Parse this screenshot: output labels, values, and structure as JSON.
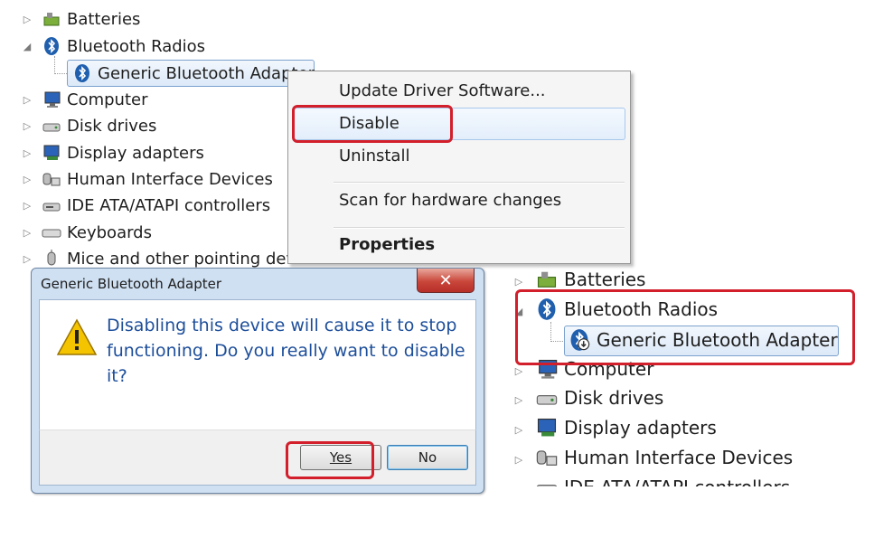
{
  "tree_top": {
    "items": [
      {
        "label": "Batteries",
        "icon": "battery-icon",
        "expanded": false
      },
      {
        "label": "Bluetooth Radios",
        "icon": "bluetooth-icon",
        "expanded": true
      },
      {
        "label": "Generic Bluetooth Adapter",
        "icon": "bluetooth-icon",
        "child": true,
        "selected": true
      },
      {
        "label": "Computer",
        "icon": "computer-icon",
        "expanded": false
      },
      {
        "label": "Disk drives",
        "icon": "disk-drive-icon",
        "expanded": false
      },
      {
        "label": "Display adapters",
        "icon": "display-adapter-icon",
        "expanded": false
      },
      {
        "label": "Human Interface Devices",
        "icon": "hid-icon",
        "expanded": false
      },
      {
        "label": "IDE ATA/ATAPI controllers",
        "icon": "ide-controller-icon",
        "expanded": false
      },
      {
        "label": "Keyboards",
        "icon": "keyboard-icon",
        "expanded": false
      },
      {
        "label": "Mice and other pointing dev",
        "icon": "mouse-icon",
        "expanded": false
      }
    ]
  },
  "context_menu": {
    "items": [
      {
        "label": "Update Driver Software..."
      },
      {
        "label": "Disable",
        "highlighted": true
      },
      {
        "label": "Uninstall"
      },
      {
        "label": "Scan for hardware changes"
      },
      {
        "label": "Properties",
        "bold": true
      }
    ]
  },
  "dialog": {
    "title": "Generic Bluetooth Adapter",
    "close_label": "✕",
    "message": "Disabling this device will cause it to stop functioning. Do you really want to disable it?",
    "yes_label": "Yes",
    "no_label": "No"
  },
  "tree_bottom": {
    "items": [
      {
        "label": "Batteries",
        "icon": "battery-icon"
      },
      {
        "label": "Bluetooth Radios",
        "icon": "bluetooth-icon",
        "expanded": true
      },
      {
        "label": "Generic Bluetooth Adapter",
        "icon": "bluetooth-disabled-icon",
        "child": true,
        "selected": true
      },
      {
        "label": "Computer",
        "icon": "computer-icon"
      },
      {
        "label": "Disk drives",
        "icon": "disk-drive-icon"
      },
      {
        "label": "Display adapters",
        "icon": "display-adapter-icon"
      },
      {
        "label": "Human Interface Devices",
        "icon": "hid-icon"
      },
      {
        "label": "IDE ATA/ATAPI controllers",
        "icon": "ide-controller-icon"
      }
    ]
  },
  "colors": {
    "highlight_red": "#d21f2b",
    "dialog_text": "#1d4e9a",
    "selection_border": "#7da2ce"
  }
}
